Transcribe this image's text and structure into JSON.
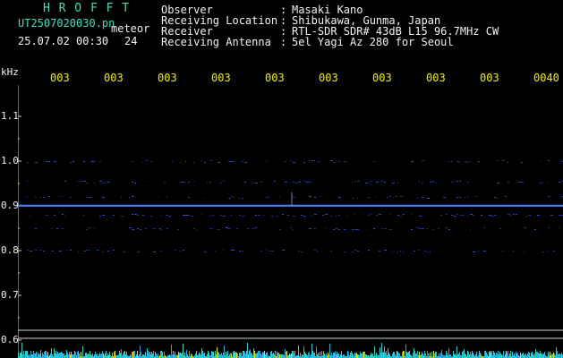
{
  "app": {
    "title": "H R O F F T",
    "filename": "UT2507020030.pn",
    "mode": "meteor",
    "datetime": "25.07.02 00:30",
    "count": "24"
  },
  "info": [
    {
      "label": "Observer",
      "value": "Masaki Kano"
    },
    {
      "label": "Receiving Location",
      "value": "Shibukawa, Gunma, Japan"
    },
    {
      "label": "Receiver",
      "value": "RTL-SDR SDR# 43dB L15 96.7MHz CW"
    },
    {
      "label": "Receiving Antenna",
      "value": "5el Yagi Az 280 for Seoul"
    }
  ],
  "axis": {
    "unit": "kHz",
    "y_labels": [
      "1.1",
      "1.0",
      "0.9",
      "0.8",
      "0.7",
      "0.6"
    ],
    "time_labels": [
      "003",
      "003",
      "003",
      "003",
      "003",
      "003",
      "003",
      "003",
      "003",
      "0040"
    ]
  },
  "colors": {
    "title": "#3fe0c0",
    "header_text": "#f2f2f2",
    "time_labels": "#f2ee00",
    "signal_line": "#3b6bff",
    "noise_bars": "#22c7e0"
  }
}
